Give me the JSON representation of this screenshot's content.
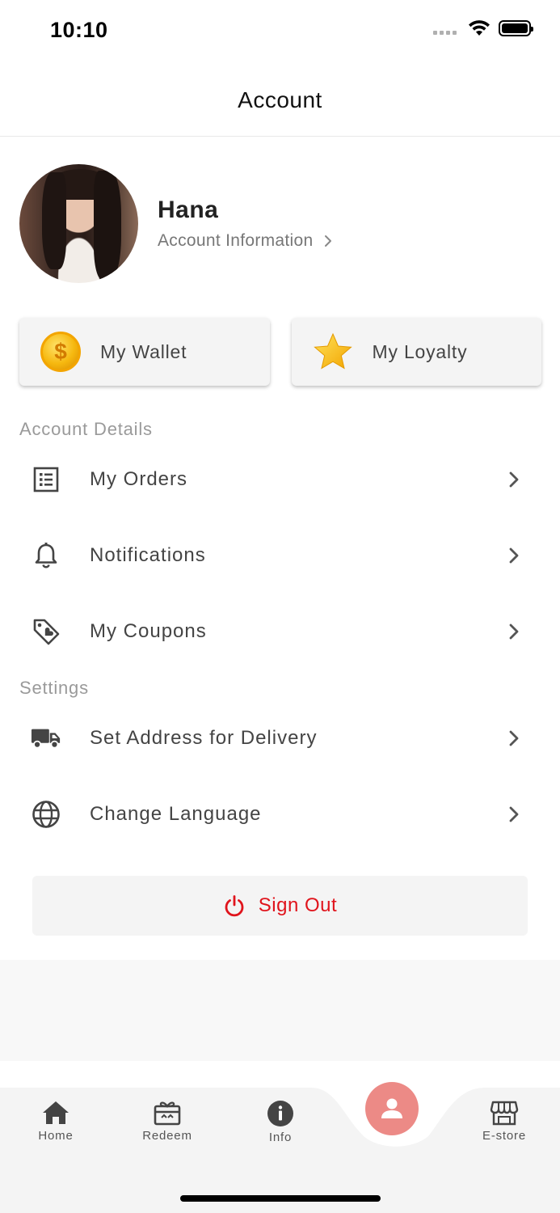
{
  "status_bar": {
    "time": "10:10"
  },
  "header": {
    "title": "Account"
  },
  "profile": {
    "name": "Hana",
    "link_label": "Account Information"
  },
  "cards": {
    "wallet": "My Wallet",
    "wallet_coin": "$",
    "loyalty": "My Loyalty"
  },
  "sections": {
    "account_details": {
      "title": "Account Details",
      "items": [
        {
          "label": "My Orders",
          "icon": "list-icon"
        },
        {
          "label": "Notifications",
          "icon": "bell-icon"
        },
        {
          "label": "My Coupons",
          "icon": "tag-heart-icon"
        }
      ]
    },
    "settings": {
      "title": "Settings",
      "items": [
        {
          "label": "Set Address for Delivery",
          "icon": "truck-icon"
        },
        {
          "label": "Change Language",
          "icon": "globe-icon"
        }
      ]
    }
  },
  "signout": {
    "label": "Sign Out"
  },
  "tabbar": {
    "tabs": [
      {
        "label": "Home",
        "icon": "home-icon"
      },
      {
        "label": "Redeem",
        "icon": "gift-card-icon"
      },
      {
        "label": "Info",
        "icon": "info-icon"
      },
      {
        "label": "",
        "icon": "account-icon",
        "active": true
      },
      {
        "label": "E-store",
        "icon": "store-icon"
      }
    ]
  },
  "colors": {
    "accent": "#ec8a86",
    "signout": "#e0141c",
    "section_title": "#9a9a9a"
  }
}
